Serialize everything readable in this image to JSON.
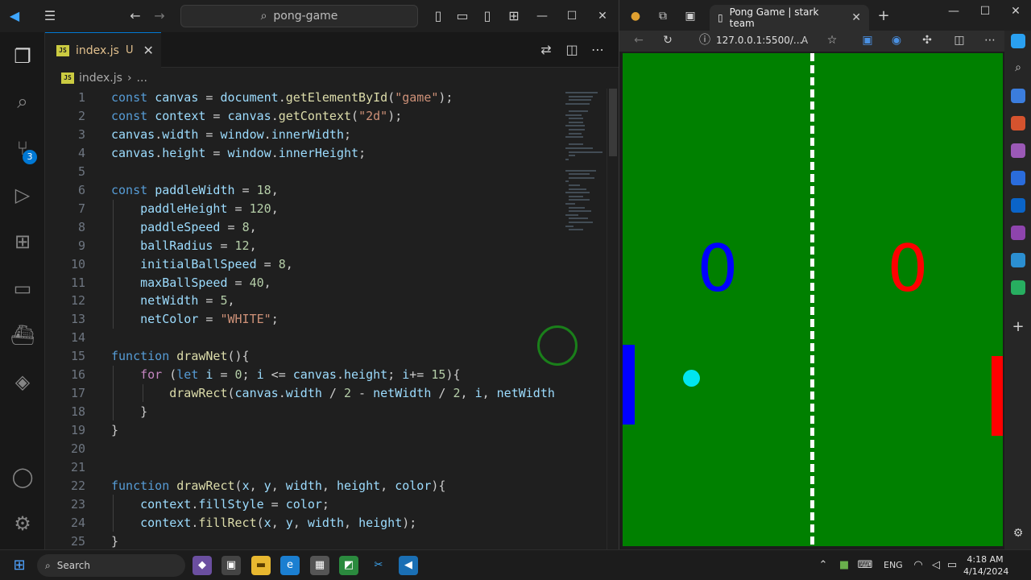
{
  "vscode": {
    "search_text": "pong-game",
    "tab": {
      "file": "index.js",
      "status": "U",
      "lang_badge": "JS"
    },
    "breadcrumb": {
      "file": "index.js",
      "ellipsis": "..."
    },
    "scm_badge": "3",
    "code_lines": [
      "const canvas = document.getElementById(\"game\");",
      "const context = canvas.getContext(\"2d\");",
      "canvas.width = window.innerWidth;",
      "canvas.height = window.innerHeight;",
      "",
      "const paddleWidth = 18,",
      "    paddleHeight = 120,",
      "    paddleSpeed = 8,",
      "    ballRadius = 12,",
      "    initialBallSpeed = 8,",
      "    maxBallSpeed = 40,",
      "    netWidth = 5,",
      "    netColor = \"WHITE\";",
      "",
      "function drawNet(){",
      "    for (let i = 0; i <= canvas.height; i+= 15){",
      "        drawRect(canvas.width / 2 - netWidth / 2, i, netWidth",
      "    }",
      "}",
      "",
      "",
      "function drawRect(x, y, width, height, color){",
      "    context.fillStyle = color;",
      "    context.fillRect(x, y, width, height);",
      "}"
    ]
  },
  "browser": {
    "tab_title": "Pong Game | stark team",
    "url": "127.0.0.1:5500/...",
    "game": {
      "score_left": "0",
      "score_right": "0",
      "background": "#008000",
      "left_color": "#0000ff",
      "right_color": "#ff0000",
      "ball_color": "#00e5ee"
    }
  },
  "taskbar": {
    "search": "Search",
    "lang": "ENG",
    "time": "4:18 AM",
    "date": "4/14/2024"
  }
}
